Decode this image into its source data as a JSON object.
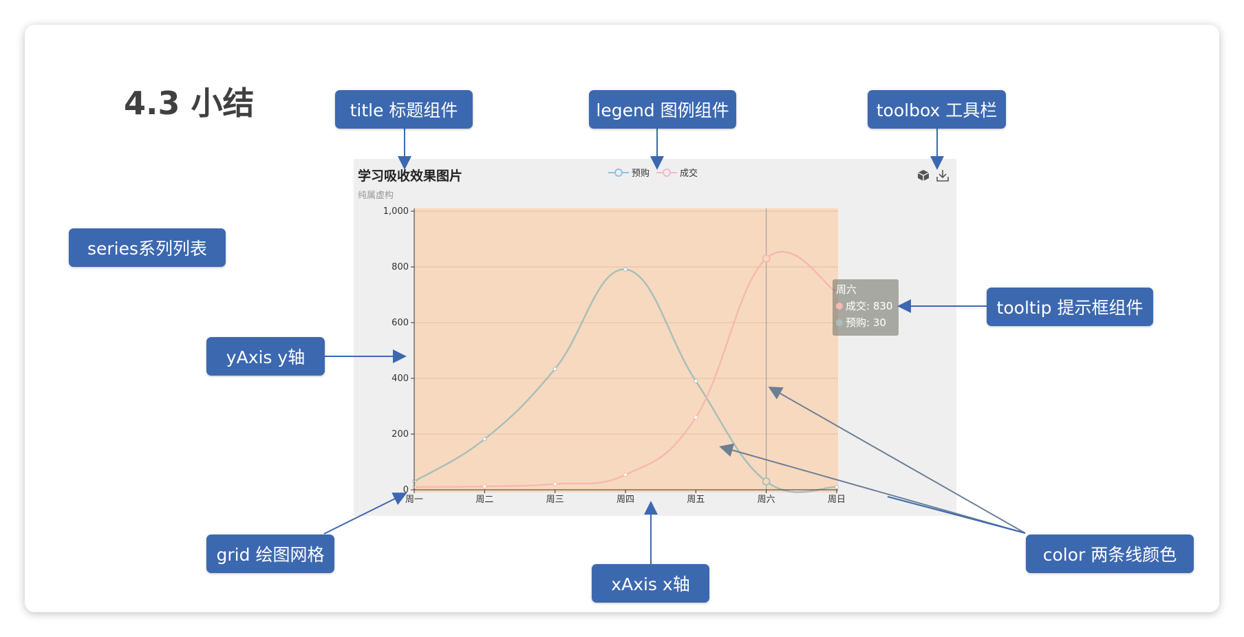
{
  "slide": {
    "title": "4.3 小结"
  },
  "callouts": {
    "title": "title 标题组件",
    "legend": "legend 图例组件",
    "toolbox": "toolbox 工具栏",
    "series": "series系列列表",
    "yaxis": "yAxis y轴",
    "tooltip": "tooltip 提示框组件",
    "grid": "grid 绘图网格",
    "xaxis": "xAxis x轴",
    "color": "color 两条线颜色"
  },
  "colors": {
    "callout": "#3c68b0",
    "arrow": "#3c68b0",
    "grid_bg": "#f7d9bf",
    "series_yugou": "#a9bfb9",
    "series_chengjiao": "#f7b9b0",
    "legend_yugou": "#8cc3e8",
    "legend_chengjiao": "#f5b8c6"
  },
  "icons": {
    "toolbox": [
      "box-icon",
      "download-icon"
    ]
  },
  "tooltip": {
    "title": "周六",
    "rows": [
      {
        "label": "成交: 830"
      },
      {
        "label": "预购: 30"
      }
    ]
  },
  "chart_data": {
    "type": "line",
    "title": "学习吸收效果图片",
    "subtitle": "纯属虚构",
    "legend": [
      "预购",
      "成交"
    ],
    "legend_position": "top-center",
    "categories": [
      "周一",
      "周二",
      "周三",
      "周四",
      "周五",
      "周六",
      "周日"
    ],
    "yticks": [
      "0",
      "200",
      "400",
      "600",
      "800",
      "1,000"
    ],
    "ylim": [
      0,
      1000
    ],
    "smooth": true,
    "grid": true,
    "series": [
      {
        "name": "预购",
        "values": [
          30,
          182,
          434,
          791,
          390,
          30,
          10
        ]
      },
      {
        "name": "成交",
        "values": [
          10,
          12,
          21,
          54,
          260,
          830,
          710
        ]
      }
    ],
    "highlight_category": "周六"
  }
}
